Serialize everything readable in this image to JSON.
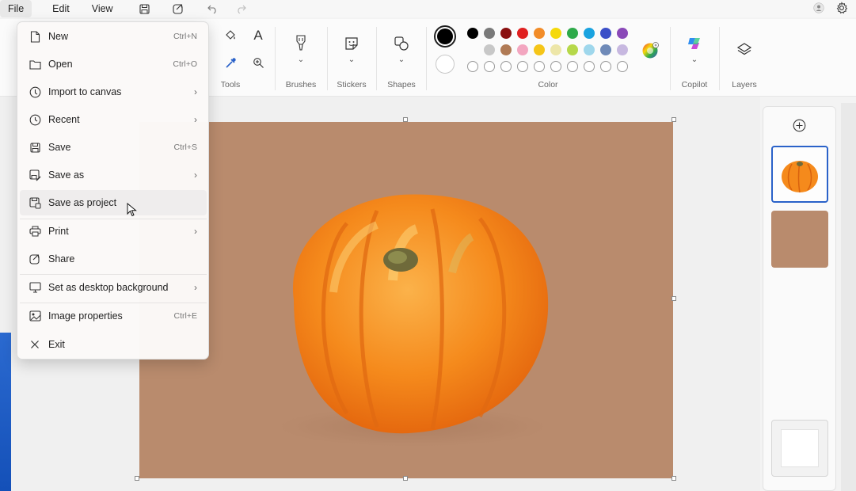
{
  "menubar": {
    "file": "File",
    "edit": "Edit",
    "view": "View"
  },
  "ribbon": {
    "groups": {
      "tools": "Tools",
      "brushes": "Brushes",
      "stickers": "Stickers",
      "shapes": "Shapes",
      "color": "Color",
      "copilot": "Copilot",
      "layers": "Layers"
    },
    "colors_row1": [
      "#000000",
      "#7a7a7a",
      "#8a1010",
      "#e02020",
      "#f28c28",
      "#f5d90a",
      "#2eaa4a",
      "#1aa3e0",
      "#3b4fc8",
      "#8a49b8"
    ],
    "colors_row2": [
      "#c8c8c8",
      "#b07a55",
      "#f3a6c0",
      "#f5c518",
      "#ede6a8",
      "#b6d84a",
      "#9fd7ec",
      "#6f8ab8",
      "#c7b8e0"
    ],
    "primary_color": "#000000",
    "secondary_color": "#ffffff"
  },
  "file_menu": {
    "items": [
      {
        "label": "New",
        "shortcut": "Ctrl+N",
        "icon": "new-file-icon"
      },
      {
        "label": "Open",
        "shortcut": "Ctrl+O",
        "icon": "folder-icon"
      },
      {
        "label": "Import to canvas",
        "submenu": "›",
        "icon": "import-icon"
      },
      {
        "label": "Recent",
        "submenu": "›",
        "icon": "clock-icon"
      },
      {
        "label": "Save",
        "shortcut": "Ctrl+S",
        "icon": "save-icon"
      },
      {
        "label": "Save as",
        "submenu": "›",
        "icon": "save-as-icon"
      },
      {
        "label": "Save as project",
        "icon": "save-project-icon"
      },
      {
        "label": "Print",
        "submenu": "›",
        "icon": "printer-icon"
      },
      {
        "label": "Share",
        "icon": "share-icon"
      },
      {
        "label": "Set as desktop background",
        "submenu": "›",
        "icon": "desktop-icon"
      },
      {
        "label": "Image properties",
        "shortcut": "Ctrl+E",
        "icon": "image-properties-icon"
      },
      {
        "label": "Exit",
        "icon": "close-icon"
      }
    ]
  },
  "canvas": {
    "background_color": "#b98b6d",
    "subject": "pumpkin"
  },
  "layers_panel": {
    "add_icon": "plus-circle-icon"
  }
}
